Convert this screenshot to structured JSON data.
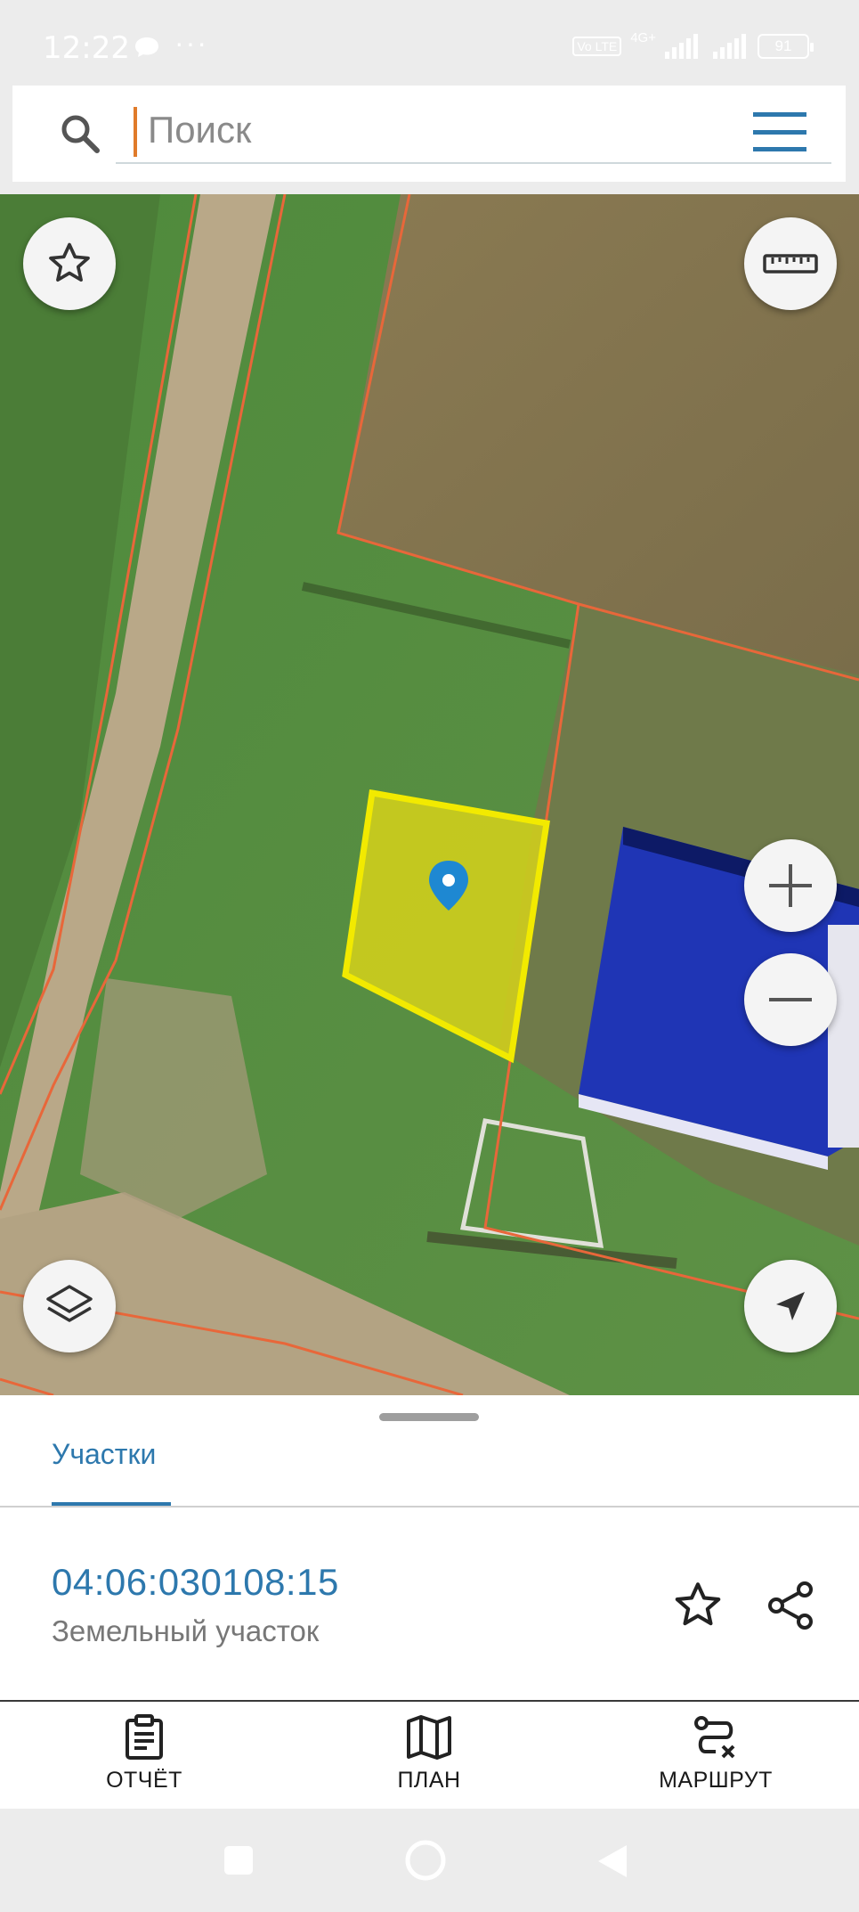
{
  "status_bar": {
    "time": "12:22",
    "dots": "···",
    "network_badge": "Vo LTE",
    "network_type": "4G+",
    "battery": "91"
  },
  "search": {
    "placeholder": "Поиск",
    "value": ""
  },
  "map": {
    "selected_parcel_color": "#f2ea00",
    "boundary_color": "#e8673a",
    "pin_color": "#1e88d2"
  },
  "sheet": {
    "tab_label": "Участки",
    "parcel_number": "04:06:030108:15",
    "parcel_type": "Земельный участок"
  },
  "bottom_nav": {
    "report_label": "ОТЧЁТ",
    "plan_label": "ПЛАН",
    "route_label": "МАРШРУТ"
  },
  "icons": {
    "search": "search-icon",
    "menu": "menu-icon",
    "favorite": "star-icon",
    "ruler": "ruler-icon",
    "zoom_in": "plus-icon",
    "zoom_out": "minus-icon",
    "layers": "layers-icon",
    "locate": "navigation-arrow-icon",
    "share": "share-icon",
    "report": "clipboard-icon",
    "plan": "map-icon",
    "route": "route-icon"
  },
  "accent_color": "#2d78ad"
}
